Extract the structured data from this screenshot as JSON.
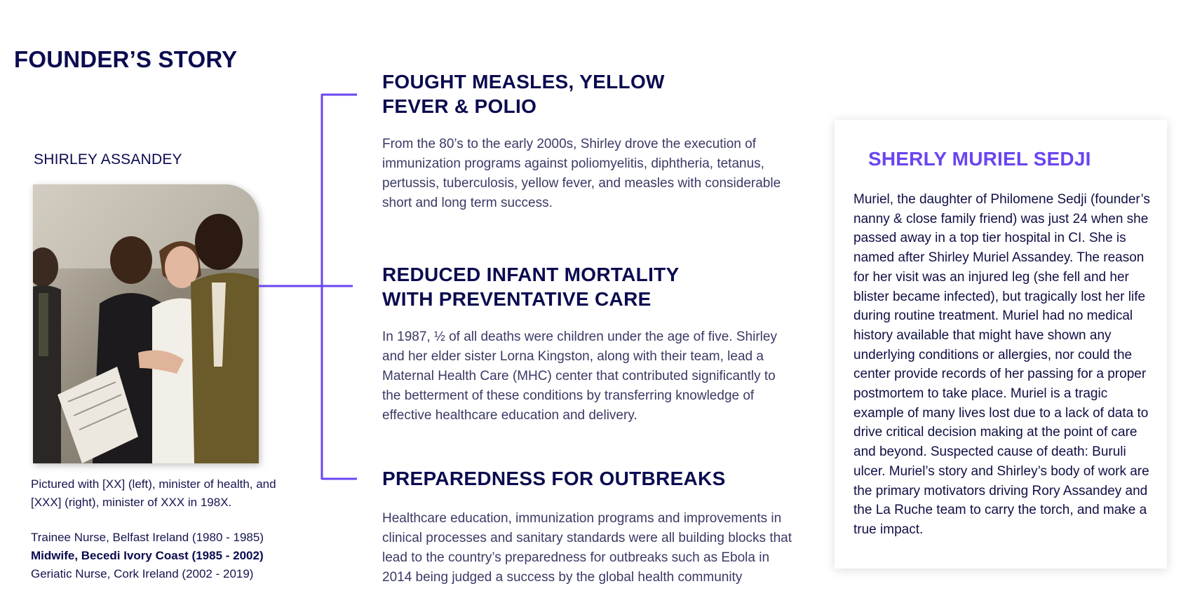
{
  "page": {
    "title": "FOUNDER’S STORY"
  },
  "founder": {
    "name": "SHIRLEY ASSANDEY",
    "caption": "Pictured with [XX] (left), minister of health, and [XXX] (right), minister of XXX in 198X.",
    "career": [
      "Trainee Nurse, Belfast Ireland (1980 - 1985)",
      "Midwife, Becedi Ivory Coast (1985 - 2002)",
      "Geriatic Nurse, Cork Ireland (2002 - 2019)"
    ]
  },
  "sections": [
    {
      "heading": "FOUGHT MEASLES, YELLOW\nFEVER & POLIO",
      "body": "From the 80’s to the early 2000s, Shirley drove the execution of immunization programs against poliomyelitis, diphtheria, tetanus, pertussis, tuberculosis, yellow fever, and measles with considerable short and long term success."
    },
    {
      "heading": "REDUCED INFANT MORTALITY\nWITH PREVENTATIVE CARE",
      "body": "In 1987, ½ of all deaths were children under the age of five. Shirley and her elder sister Lorna Kingston, along with their team, lead a Maternal Health Care (MHC) center that contributed significantly to the betterment of these conditions by transferring knowledge of effective healthcare education and delivery."
    },
    {
      "heading": "PREPAREDNESS FOR OUTBREAKS",
      "body": "Healthcare education, immunization programs and improvements in clinical processes and sanitary standards were all building blocks that lead to the country’s preparedness for outbreaks such as Ebola in 2014 being judged a success by the global health community"
    }
  ],
  "memorial": {
    "title": "SHERLY MURIEL SEDJI",
    "body": "Muriel, the daughter of Philomene Sedji (founder’s nanny & close family friend) was just 24 when she passed away in a top tier hospital in CI. She is named after Shirley Muriel Assandey. The reason for her visit was an injured leg (she fell and her blister became infected), but tragically lost her life during routine treatment. Muriel had no medical history available that might have shown any underlying conditions or allergies, nor could the center provide records of her passing for a proper postmortem to take place.  Muriel is a tragic example of many lives lost due to a lack of data to drive critical decision making at the point of care and beyond. Suspected cause of death: Buruli ulcer. Muriel’s story and Shirley’s body of work are the primary motivators driving Rory Assandey and the La Ruche team to carry the torch, and make a true impact."
  },
  "colors": {
    "navy": "#0b0b50",
    "accent": "#6b45f0",
    "body_text": "#3a3a66"
  }
}
